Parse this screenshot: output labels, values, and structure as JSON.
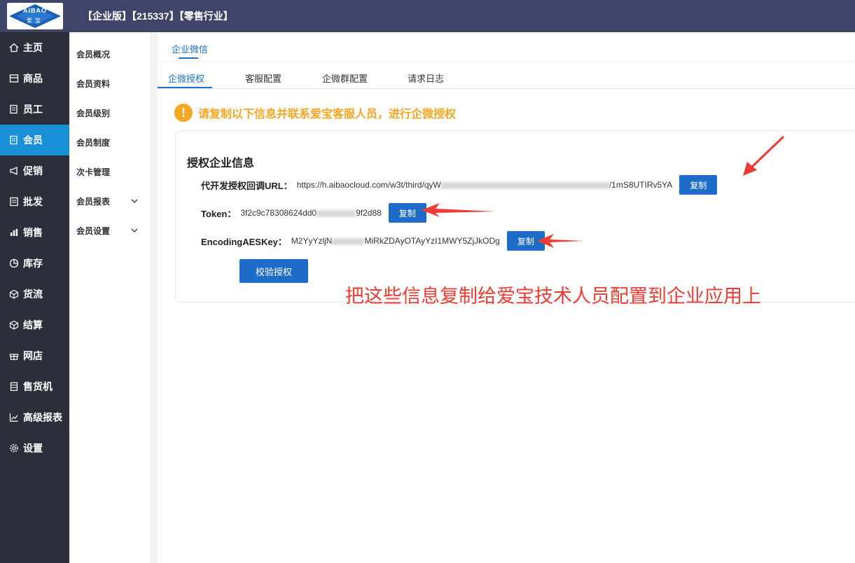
{
  "header": {
    "logo_top": "AIBAO",
    "logo_bottom": "爱宝",
    "title": "【企业版】【215337】【零售行业】"
  },
  "sidebar": {
    "items": [
      {
        "label": "主页",
        "icon": "home-icon"
      },
      {
        "label": "商品",
        "icon": "goods-icon"
      },
      {
        "label": "员工",
        "icon": "staff-icon"
      },
      {
        "label": "会员",
        "icon": "member-icon"
      },
      {
        "label": "促销",
        "icon": "megaphone-icon"
      },
      {
        "label": "批发",
        "icon": "list-icon"
      },
      {
        "label": "销售",
        "icon": "bar-chart-icon"
      },
      {
        "label": "库存",
        "icon": "pie-chart-icon"
      },
      {
        "label": "货流",
        "icon": "cube-icon"
      },
      {
        "label": "结算",
        "icon": "cube-icon"
      },
      {
        "label": "网店",
        "icon": "gift-icon"
      },
      {
        "label": "售货机",
        "icon": "vending-icon"
      },
      {
        "label": "高级报表",
        "icon": "line-chart-icon"
      },
      {
        "label": "设置",
        "icon": "gear-icon"
      }
    ],
    "active_index": 3,
    "active_color": "#1890d8"
  },
  "submenu": {
    "items": [
      {
        "label": "会员概况"
      },
      {
        "label": "会员资料"
      },
      {
        "label": "会员级别"
      },
      {
        "label": "会员制度"
      },
      {
        "label": "次卡管理"
      },
      {
        "label": "会员报表"
      },
      {
        "label": "会员设置"
      }
    ]
  },
  "main": {
    "top_tab": "企业微信",
    "subtabs": [
      "企微授权",
      "客服配置",
      "企微群配置",
      "请求日志"
    ],
    "warning": "请复制以下信息并联系爱宝客服人员，进行企微授权",
    "card": {
      "title": "授权企业信息",
      "url_label": "代开发授权回调URL：",
      "url_prefix": "https://h.aibaocloud.com/w3t/third/qyW",
      "url_suffix": "/1mS8UTIRv5YA",
      "token_label": "Token：",
      "token_prefix": "3f2c9c78308624dd0",
      "token_suffix": "9f2d88",
      "aes_label": "EncodingAESKey：",
      "aes_prefix": "M2YyYzljN",
      "aes_suffix": "MiRkZDAyOTAyYzI1MWY5ZjJkODg",
      "copy_label": "复制",
      "verify_label": "校验授权"
    },
    "annotation": "把这些信息复制给爱宝技术人员配置到企业应用上"
  },
  "colors": {
    "header_bg": "#3f4468",
    "sidebar_bg": "#2b2f3a",
    "primary": "#1e6cc8",
    "warning": "#f5a623",
    "annotation": "#ee3b33"
  }
}
